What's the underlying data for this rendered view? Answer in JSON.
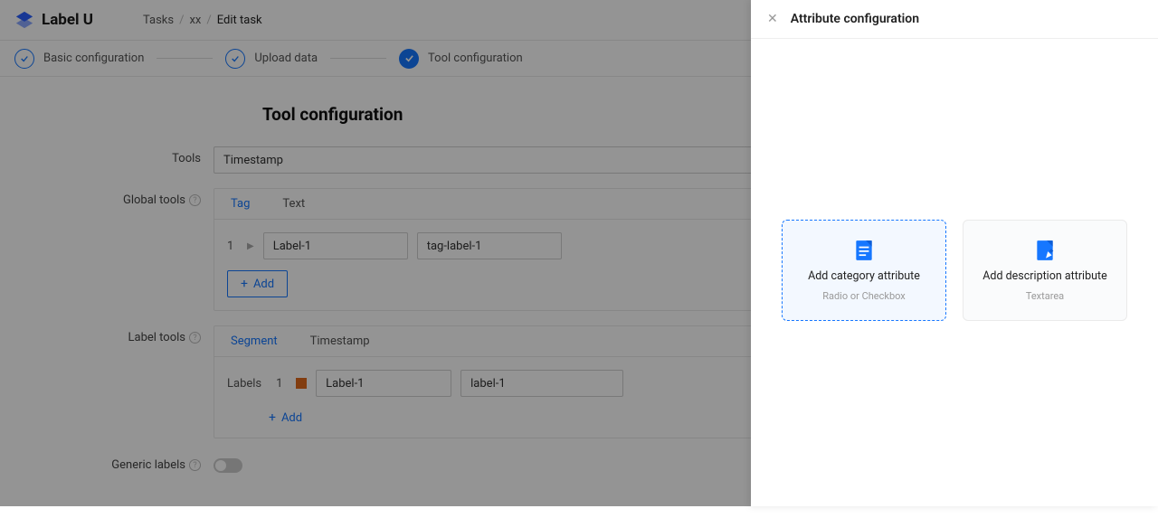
{
  "brand": "Label U",
  "breadcrumb": {
    "a": "Tasks",
    "b": "xx",
    "c": "Edit task"
  },
  "steps": {
    "s1": "Basic configuration",
    "s2": "Upload data",
    "s3": "Tool configuration"
  },
  "section": {
    "title": "Tool configuration"
  },
  "form": {
    "tools_label": "Tools",
    "tools_value": "Timestamp",
    "global_tools_label": "Global tools",
    "label_tools_label": "Label tools",
    "generic_labels_label": "Generic labels"
  },
  "global_tabs": {
    "tag": "Tag",
    "text": "Text"
  },
  "tag_row": {
    "idx": "1",
    "name": "Label-1",
    "key": "tag-label-1"
  },
  "add_btn": "Add",
  "label_tabs": {
    "segment": "Segment",
    "timestamp": "Timestamp"
  },
  "labels_text": "Labels",
  "label_row": {
    "idx": "1",
    "name": "Label-1",
    "key": "label-1"
  },
  "add_link": "Add",
  "drawer": {
    "title": "Attribute configuration",
    "card1": {
      "title": "Add category attribute",
      "sub": "Radio or Checkbox"
    },
    "card2": {
      "title": "Add description attribute",
      "sub": "Textarea"
    }
  }
}
